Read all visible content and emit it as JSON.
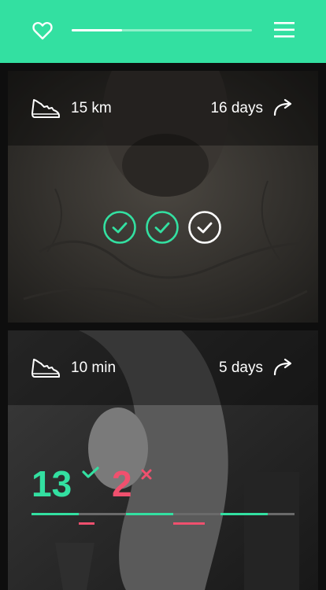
{
  "topbar": {
    "background": "#33e0a1",
    "left_icon": "heart-icon",
    "right_icon": "hamburger-menu-icon",
    "progress_fraction": 0.28
  },
  "cards": [
    {
      "icon": "running-shoe-icon",
      "metric": "15 km",
      "duration": "16 days",
      "action_icon": "share-arrow-icon",
      "checks": [
        {
          "state": "done",
          "color": "#33e0a1"
        },
        {
          "state": "done",
          "color": "#33e0a1"
        },
        {
          "state": "current",
          "color": "#ffffff"
        }
      ]
    },
    {
      "icon": "running-shoe-icon",
      "metric": "10 min",
      "duration": "5 days",
      "action_icon": "share-arrow-icon",
      "success_count": "13",
      "fail_count": "2",
      "success_color": "#33e0a1",
      "fail_color": "#f0506e",
      "timeline": [
        "success",
        "fail",
        "success",
        "fail",
        "success",
        "empty",
        "empty"
      ]
    }
  ]
}
